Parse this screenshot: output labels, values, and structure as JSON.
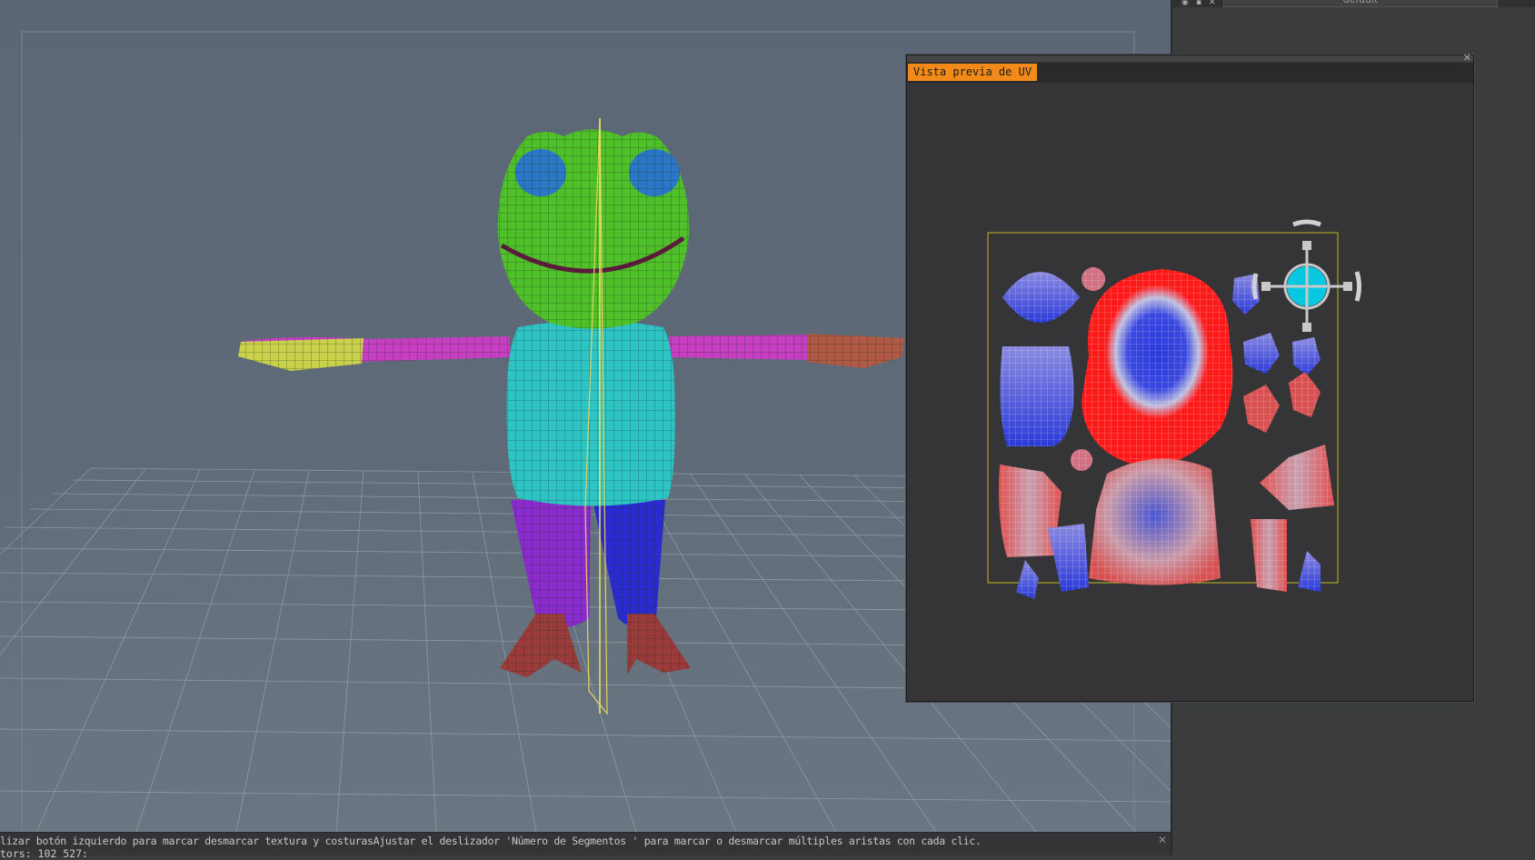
{
  "uv_window": {
    "tab_label": "Vista previa de UV",
    "close_glyph": "✕"
  },
  "right_panel": {
    "tab_label": "default"
  },
  "status": {
    "message": "lizar botón izquierdo para marcar desmarcar textura y costurasAjustar el deslizador 'Número de Segmentos ' para marcar o desmarcar múltiples aristas con cada clic.",
    "line2": "tors: 102 527:",
    "close_glyph": "✕"
  },
  "colors": {
    "viewport_bg": "#5e6a78",
    "tab_accent": "#f28a1a",
    "head": "#4fbf2a",
    "body": "#2ec4c4",
    "arms": "#c63fc2",
    "legs_left": "#8a2bd0",
    "legs_right": "#2a2bd0",
    "feet": "#9a3a3a",
    "uv_red": "#ff1a1a",
    "uv_blue": "#2a3ad8",
    "gizmo": "#00e0ff"
  },
  "icons": [
    "eye-icon",
    "lock-icon",
    "close-icon",
    "move-gizmo-icon"
  ]
}
